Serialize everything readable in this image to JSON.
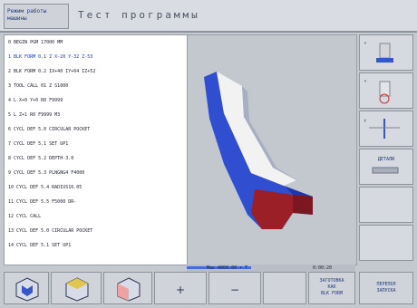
{
  "header": {
    "mode_line1": "Режим работы",
    "mode_line2": "машины",
    "title": "Тест программы"
  },
  "program": {
    "lines": [
      "0  BEGIN PGM 17000 MM",
      "1  BLK FORM 0.1 Z  X-20  Y-32  Z-53",
      "2  BLK FORM 0.2 IX+40 IY+64 IZ+52",
      "3  TOOL CALL 01 Z S1000",
      "4  L  X+0  Y+0 R0 F9999",
      "5  L  Z+1 R0 F9999 M3",
      "6  CYCL DEF 5.0 CIRCULAR POCKET",
      "7  CYCL DEF 5.1 SET UP1",
      "8  CYCL DEF 5.2 DEPTH-3.0",
      "9  CYCL DEF 5.3 PLNGNG4 F4000",
      "10 CYCL DEF 5.4 RADIUS16.05",
      "11 CYCL DEF 5.5 F5000 DR-",
      "12 CYCL CALL",
      "13 CYCL DEF 5.0 CIRCULAR POCKET",
      "14 CYCL DEF 5.1 SET UP1"
    ],
    "active_index": 1
  },
  "status": {
    "time_text": "Мас 4000.00 • T",
    "clock_text": "0:00:20",
    "progress": 0.38
  },
  "right_softkeys": [
    {
      "icon": "tool-view-1-icon",
      "label": ""
    },
    {
      "icon": "tool-view-2-icon",
      "label": ""
    },
    {
      "icon": "tool-measure-icon",
      "label": ""
    },
    {
      "icon": "blank-icon",
      "label": "ДЕТАЛИ"
    },
    {
      "icon": "",
      "label": ""
    },
    {
      "icon": "",
      "label": ""
    }
  ],
  "bottom_softkeys": {
    "view1": "3d-view-1-icon",
    "view2": "3d-view-2-icon",
    "view3": "3d-view-3-icon",
    "plus": "+",
    "minus": "−",
    "blk_line1": "ЗАГОТОВКА",
    "blk_line2": "КАК",
    "blk_line3": "BLK FORM",
    "reset_line1": "ПЕРЕПОЛ",
    "reset_line2": "ЗАПУСКА"
  },
  "colors": {
    "part_blue": "#2f4fd0",
    "part_red": "#9a1f27",
    "part_white": "#f2f2f2",
    "accent": "#4b6bd6"
  }
}
